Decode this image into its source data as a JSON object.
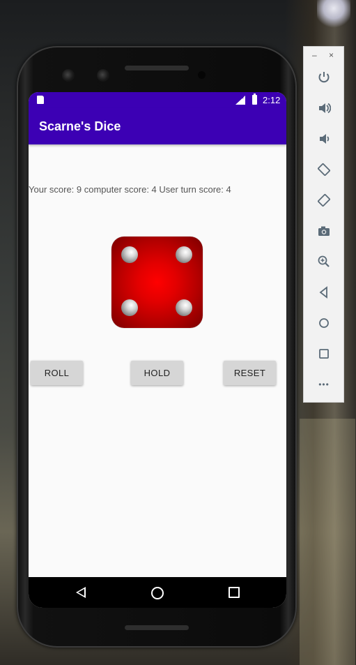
{
  "app": {
    "title": "Scarne's Dice",
    "status_time": "2:12",
    "status_network": "LTE"
  },
  "game": {
    "score_text": "Your score: 9 computer score: 4 User turn score: 4",
    "dice_face": 4,
    "dice_color": "#e00000"
  },
  "buttons": {
    "roll": "ROLL",
    "hold": "HOLD",
    "reset": "RESET"
  },
  "theme": {
    "primary": "#3c00b4",
    "background": "#fafafa",
    "button_bg": "#d6d6d6"
  },
  "emulator_toolbar": {
    "minimize": "–",
    "close": "×",
    "items": [
      "power-icon",
      "volume-up-icon",
      "volume-down-icon",
      "rotate-left-icon",
      "rotate-right-icon",
      "camera-icon",
      "zoom-icon",
      "back-icon",
      "home-icon",
      "overview-icon",
      "more-icon"
    ],
    "more": "•••"
  }
}
